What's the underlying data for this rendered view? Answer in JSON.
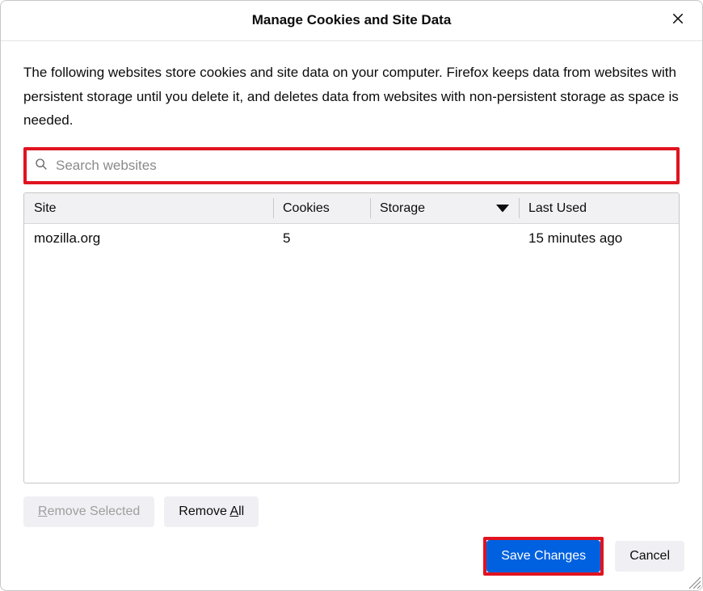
{
  "title": "Manage Cookies and Site Data",
  "description": "The following websites store cookies and site data on your computer. Firefox keeps data from websites with persistent storage until you delete it, and deletes data from websites with non-persistent storage as space is needed.",
  "search": {
    "placeholder": "Search websites",
    "value": ""
  },
  "columns": {
    "site": "Site",
    "cookies": "Cookies",
    "storage": "Storage",
    "last_used": "Last Used"
  },
  "sort_column": "storage",
  "rows": [
    {
      "site": "mozilla.org",
      "cookies": "5",
      "storage": "",
      "last_used": "15 minutes ago"
    }
  ],
  "buttons": {
    "remove_selected": "Remove Selected",
    "remove_all": "Remove All",
    "save": "Save Changes",
    "cancel": "Cancel"
  },
  "colors": {
    "accent": "#0061e0",
    "highlight": "#e11320"
  }
}
